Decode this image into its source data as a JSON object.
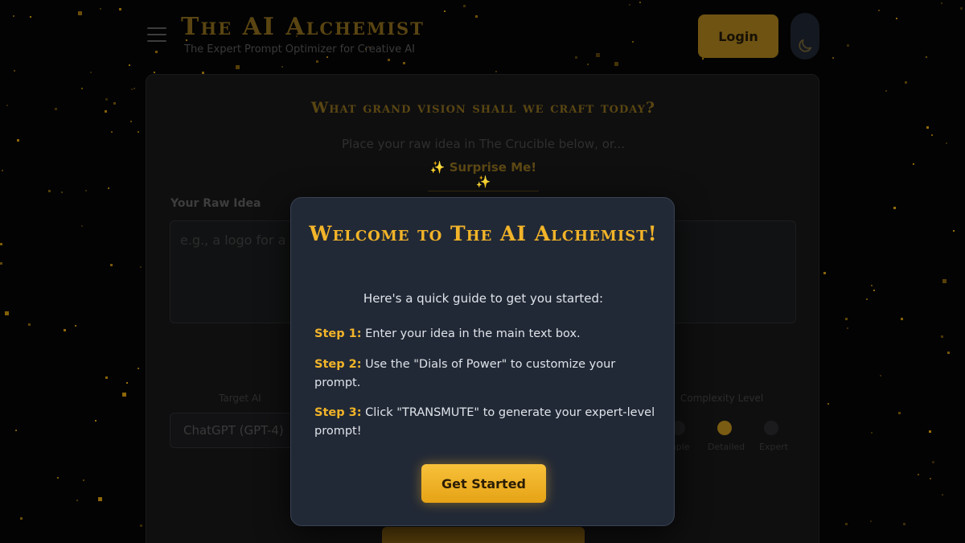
{
  "header": {
    "title": "The AI Alchemist",
    "subtitle": "The Expert Prompt Optimizer for Creative AI",
    "login_label": "Login",
    "menu_icon": "hamburger-menu-icon",
    "theme_icon": "moon-icon"
  },
  "main": {
    "heading": "What grand vision shall we craft today?",
    "subheading": "Place your raw idea in The Crucible below, or...",
    "surprise_label": "✨ Surprise Me! ✨",
    "raw_idea_label": "Your Raw Idea",
    "raw_idea_placeholder": "e.g., a logo for a",
    "target_ai_label": "Target AI",
    "target_ai_value": "ChatGPT (GPT-4)",
    "complexity_label": "Complexity Level",
    "complexity_options": [
      "Simple",
      "Detailed",
      "Expert"
    ],
    "complexity_selected": "Detailed"
  },
  "modal": {
    "title": "Welcome to The AI Alchemist!",
    "intro": "Here's a quick guide to get you started:",
    "steps": [
      {
        "label": "Step 1:",
        "text": " Enter your idea in the main text box."
      },
      {
        "label": "Step 2:",
        "text": " Use the \"Dials of Power\" to customize your prompt."
      },
      {
        "label": "Step 3:",
        "text": " Click \"TRANSMUTE\" to generate your expert-level prompt!"
      }
    ],
    "button_label": "Get Started"
  },
  "colors": {
    "background": "#030303",
    "accent_gold": "#f2b429",
    "modal_bg": "#222936",
    "text": "#dfe3ea"
  }
}
